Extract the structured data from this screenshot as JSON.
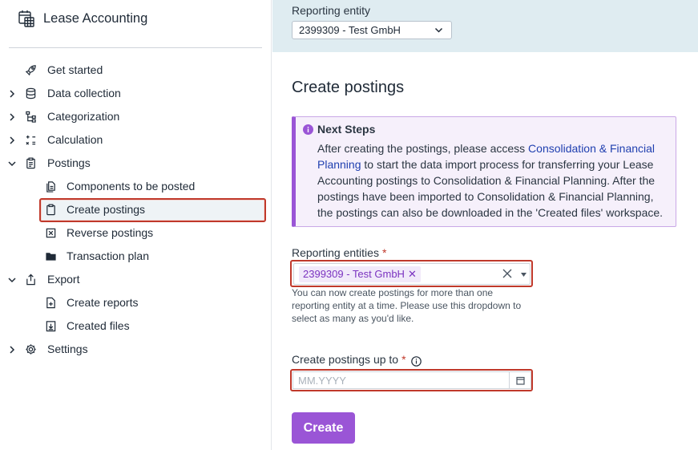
{
  "app": {
    "title": "Lease Accounting",
    "icon": "calendar-grid-icon"
  },
  "sidebar": {
    "items": [
      {
        "label": "Get started",
        "icon": "rocket-icon",
        "chevron": ""
      },
      {
        "label": "Data collection",
        "icon": "database-icon",
        "chevron": "right"
      },
      {
        "label": "Categorization",
        "icon": "hierarchy-icon",
        "chevron": "right"
      },
      {
        "label": "Calculation",
        "icon": "calculation-icon",
        "chevron": "right"
      },
      {
        "label": "Postings",
        "icon": "clipboard-icon",
        "chevron": "down"
      },
      {
        "label": "Components to be posted",
        "icon": "documents-icon",
        "sub": true
      },
      {
        "label": "Create postings",
        "icon": "clipboard-icon",
        "sub": true,
        "active": true
      },
      {
        "label": "Reverse postings",
        "icon": "x-box-icon",
        "sub": true
      },
      {
        "label": "Transaction plan",
        "icon": "folder-icon",
        "sub": true
      },
      {
        "label": "Export",
        "icon": "export-icon",
        "chevron": "down"
      },
      {
        "label": "Create reports",
        "icon": "file-add-icon",
        "sub": true
      },
      {
        "label": "Created files",
        "icon": "file-download-icon",
        "sub": true
      },
      {
        "label": "Settings",
        "icon": "gear-icon",
        "chevron": "right"
      }
    ]
  },
  "header": {
    "reporting_entity_label": "Reporting entity",
    "reporting_entity_value": "2399309 - Test GmbH"
  },
  "main": {
    "title": "Create postings",
    "notice": {
      "title": "Next Steps",
      "body_before": "After creating the postings, please access ",
      "link": "Consolidation & Financial Planning",
      "body_after": " to start the data import process for transferring your Lease Accounting postings to Consolidation & Financial Planning. After the postings have been imported to Consolidation & Financial Planning, the postings can also be downloaded in the 'Created files' workspace."
    },
    "entities_field": {
      "label": "Reporting entities",
      "required": "*",
      "chip": "2399309 - Test GmbH",
      "hint": "You can now create postings for more than one reporting entity at a time. Please use this dropdown to select as many as you'd like."
    },
    "date_field": {
      "label": "Create postings up to",
      "required": "*",
      "placeholder": "MM.YYYY"
    },
    "create_button": "Create"
  },
  "colors": {
    "accent": "#9a55d6",
    "highlight": "#c0392b",
    "link": "#2040b0"
  }
}
